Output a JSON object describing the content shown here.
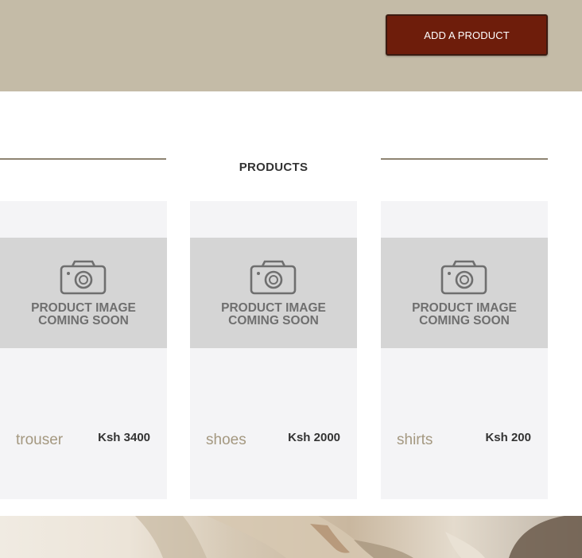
{
  "header": {
    "add_product_label": "ADD A PRODUCT"
  },
  "section": {
    "title": "PRODUCTS"
  },
  "placeholder_image": {
    "line1": "PRODUCT IMAGE",
    "line2": "COMING SOON"
  },
  "products": [
    {
      "name": "trouser",
      "price": "Ksh 3400"
    },
    {
      "name": "shoes",
      "price": "Ksh 2000"
    },
    {
      "name": "shirts",
      "price": "Ksh 200"
    }
  ],
  "colors": {
    "header_bg": "#c4bba7",
    "button_bg": "#6e1d0b",
    "rule": "#8e8472",
    "card_bg": "#f4f4f6",
    "product_name": "#a49880"
  }
}
